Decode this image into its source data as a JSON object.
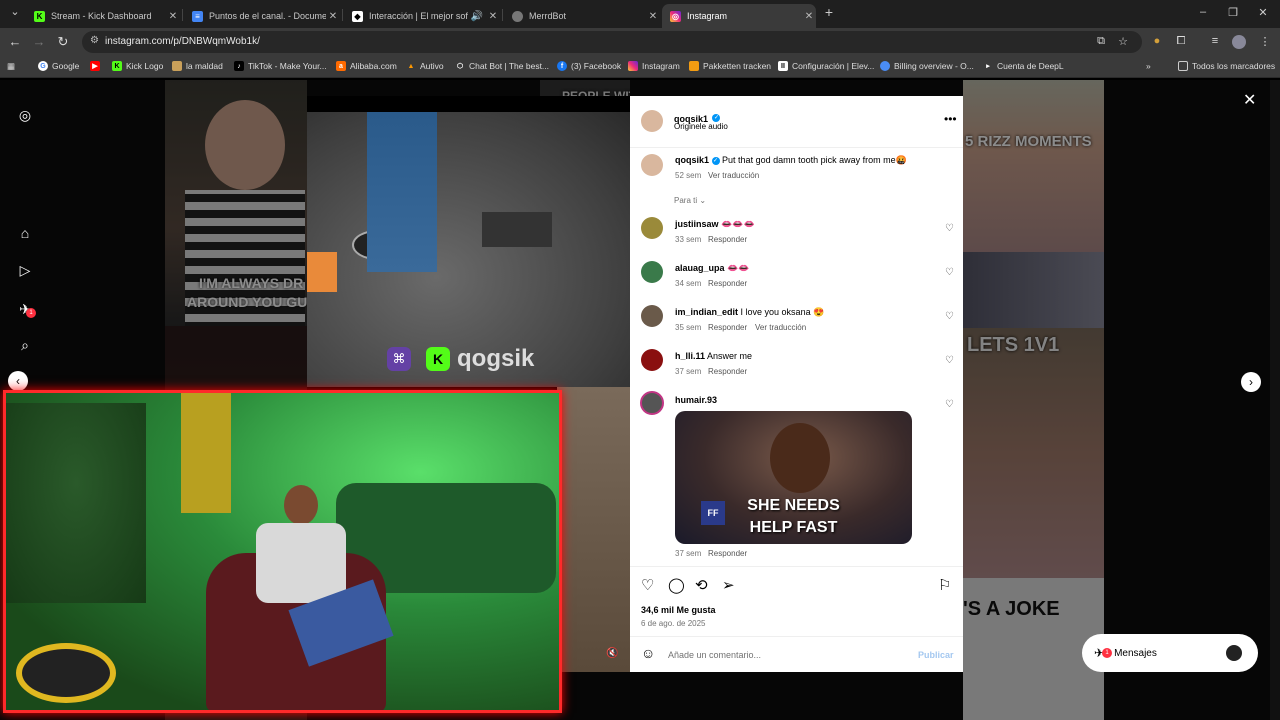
{
  "tabs": [
    {
      "title": "Stream - Kick Dashboard",
      "icon": "kick-icon",
      "color": "#53fc18"
    },
    {
      "title": "Puntos de el canal. - Document",
      "icon": "docs-icon",
      "color": "#4285f4"
    },
    {
      "title": "Interacción | El mejor softw",
      "icon": "interaction-icon",
      "color": "#ffffff"
    },
    {
      "title": "MerrdBot",
      "icon": "globe-icon",
      "color": "#888888"
    },
    {
      "title": "Instagram",
      "icon": "instagram-icon",
      "color": "#e1306c"
    }
  ],
  "address": {
    "url": "instagram.com/p/DNBWqmWob1k/"
  },
  "bookmarks": [
    {
      "label": "Google"
    },
    {
      "label": "Kick Logo"
    },
    {
      "label": "la maldad"
    },
    {
      "label": "TikTok - Make Your..."
    },
    {
      "label": "Alibaba.com"
    },
    {
      "label": "Autivo"
    },
    {
      "label": "Chat Bot | The best..."
    },
    {
      "label": "(3) Facebook"
    },
    {
      "label": "Instagram"
    },
    {
      "label": "Pakketten tracken"
    },
    {
      "label": "Configuración | Elev..."
    },
    {
      "label": "Billing overview - O..."
    },
    {
      "label": "Cuenta de DeepL"
    },
    {
      "label": "Todos los marcadores"
    }
  ],
  "background": {
    "text1": "I'M ALWAYS DR",
    "text1b": "AROUND YOU GU",
    "text2": "PEOPLE WITH HUGE",
    "text3": "5 RIZZ MOMENTS",
    "text4": "LETS 1V1",
    "text5": "'S A JOKE"
  },
  "reel": {
    "watermark": "qogsik"
  },
  "post": {
    "username": "qoqsik1",
    "audio": "Originele audio",
    "caption": "Put that god damn tooth pick away from me🤬",
    "caption_age": "52 sem",
    "translate": "Ver traducción",
    "filter": "Para ti",
    "likes": "34,6 mil Me gusta",
    "date": "6 de ago. de 2025",
    "comment_placeholder": "Añade un comentario...",
    "publish": "Publicar"
  },
  "comments": [
    {
      "user": "justiinsaw",
      "text": "👄👄👄",
      "age": "33 sem",
      "reply": "Responder"
    },
    {
      "user": "alauag_upa",
      "text": "👄👄",
      "age": "34 sem",
      "reply": "Responder"
    },
    {
      "user": "im_indian_edit",
      "text": "I love you oksana 😍",
      "age": "35 sem",
      "reply": "Responder",
      "translate": "Ver traducción"
    },
    {
      "user": "h_lli.11",
      "text": "Answer me",
      "age": "37 sem",
      "reply": "Responder"
    },
    {
      "user": "humair.93",
      "text": "",
      "age": "37 sem",
      "reply": "Responder",
      "gif_text1": "SHE NEEDS",
      "gif_text2": "HELP FAST"
    }
  ],
  "messages": {
    "label": "Mensajes",
    "badge": "1"
  },
  "notifications_badge": "1"
}
